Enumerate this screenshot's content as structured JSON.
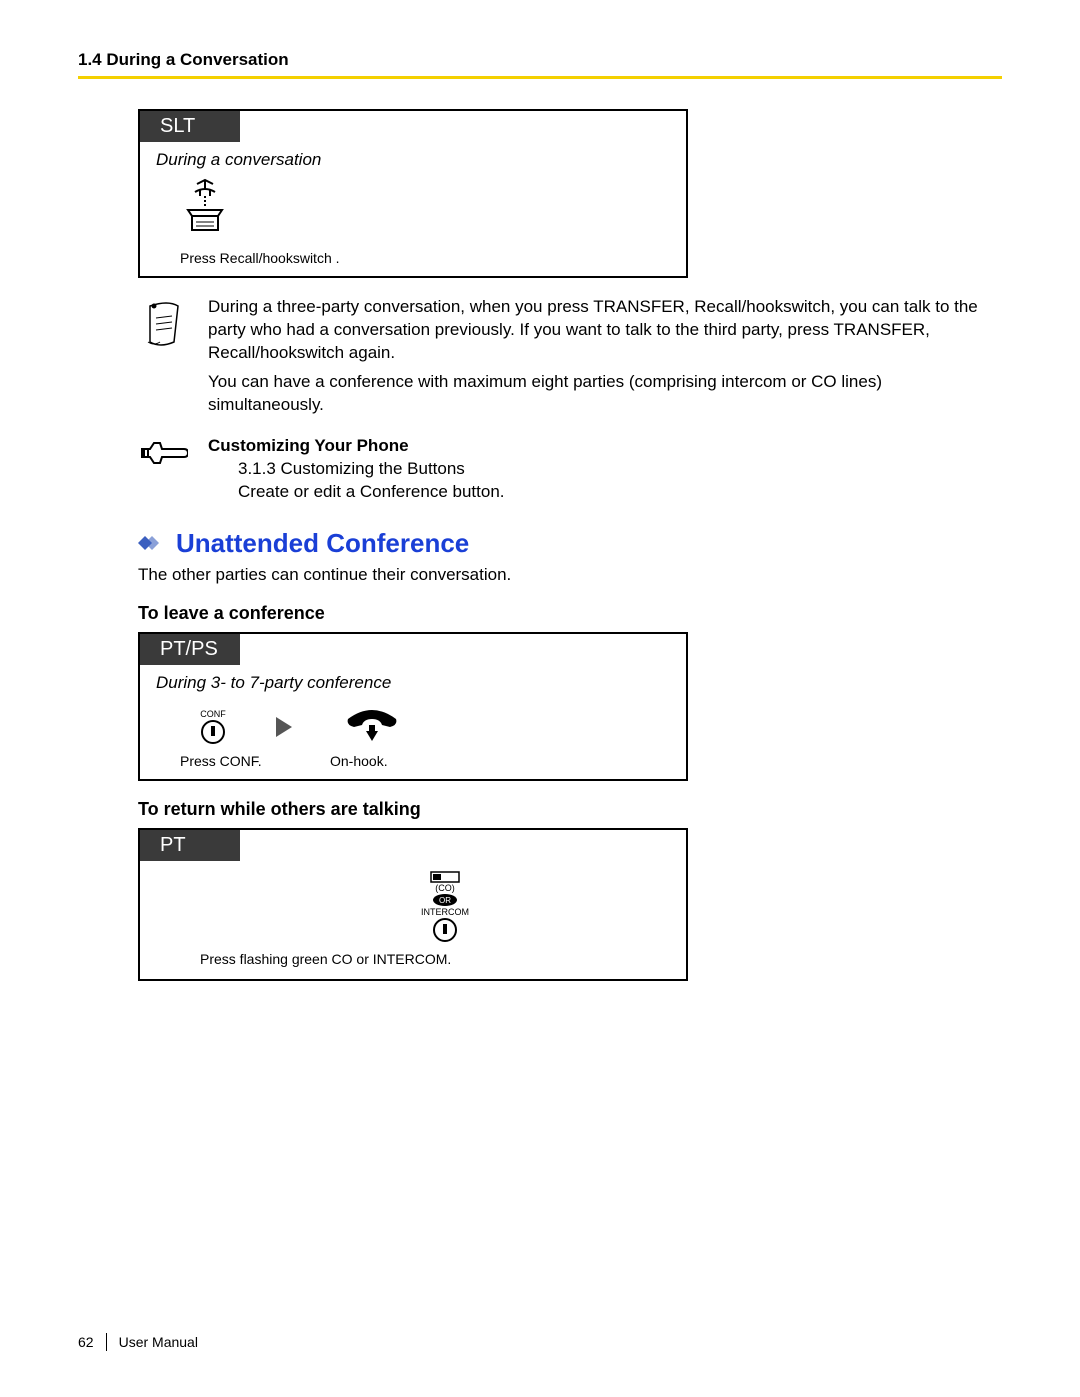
{
  "header": {
    "title": "1.4 During a Conversation"
  },
  "box1": {
    "tab": "SLT",
    "subtitle": "During a conversation",
    "caption": "Press Recall/hookswitch  ."
  },
  "note1": {
    "p1": "During a three-party conversation, when you press TRANSFER, Recall/hookswitch, you can talk to the party who had a conversation previously. If you want to talk to the third party, press TRANSFER, Recall/hookswitch again.",
    "p2": "You can have a conference with maximum eight parties (comprising intercom or CO lines) simultaneously."
  },
  "note2": {
    "title": "Customizing Your Phone",
    "line1": "3.1.3 Customizing the Buttons",
    "line2": "Create or edit a Conference button."
  },
  "section": {
    "heading": "Unattended Conference",
    "body": "The other parties can continue their conversation."
  },
  "sub1": "To leave a conference",
  "box2": {
    "tab": "PT/PS",
    "subtitle": "During 3- to 7-party conference",
    "conf_label": "CONF",
    "caption_left": "Press CONF.",
    "caption_right": "On-hook."
  },
  "sub2": "To return while others are talking",
  "box3": {
    "tab": "PT",
    "co_label": "(CO)",
    "or_label": "OR",
    "intercom_label": "INTERCOM",
    "caption": "Press flashing green CO or INTERCOM."
  },
  "footer": {
    "page": "62",
    "label": "User Manual"
  }
}
